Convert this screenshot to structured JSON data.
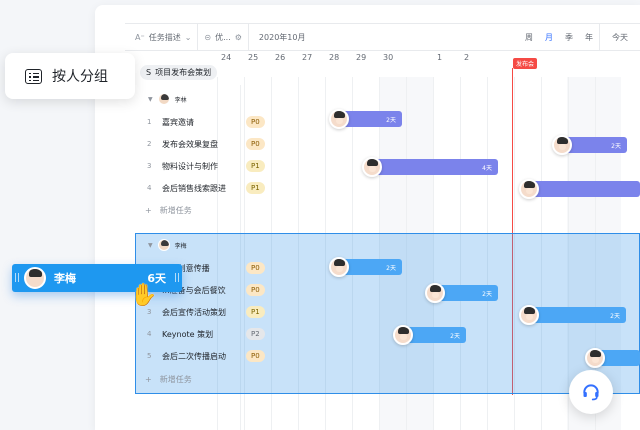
{
  "toolbar": {
    "task_desc": "任务描述",
    "priority": "优...",
    "month": "2020年10月",
    "views": [
      "周",
      "月",
      "季",
      "年"
    ],
    "active_view": "月",
    "today": "今天"
  },
  "dates": [
    "24",
    "25",
    "26",
    "27",
    "28",
    "29",
    "30",
    "1",
    "2"
  ],
  "today_flag": "发布会",
  "project": {
    "tag": "S",
    "name": "项目发布会策划"
  },
  "groups": [
    {
      "owner": "李林",
      "tasks": [
        {
          "num": "1",
          "name": "嘉宾邀请",
          "priority": "P0",
          "duration": "2天"
        },
        {
          "num": "2",
          "name": "发布会效果复盘",
          "priority": "P0",
          "duration": "2天"
        },
        {
          "num": "3",
          "name": "物料设计与制作",
          "priority": "P1",
          "duration": "4天"
        },
        {
          "num": "4",
          "name": "会后销售线索跟进",
          "priority": "P1",
          "duration": ""
        }
      ],
      "add_task": "新增任务"
    },
    {
      "owner": "李梅",
      "tasks": [
        {
          "num": "1",
          "name": "...段创意传播",
          "priority": "P0",
          "duration": "2天"
        },
        {
          "num": "2",
          "name": "...准备与会后餐饮",
          "priority": "P0",
          "duration": "2天"
        },
        {
          "num": "3",
          "name": "会后宣传活动策划",
          "priority": "P1",
          "duration": "2天"
        },
        {
          "num": "4",
          "name": "Keynote 策划",
          "priority": "P2",
          "duration": "2天"
        },
        {
          "num": "5",
          "name": "会后二次传播启动",
          "priority": "P0",
          "duration": ""
        }
      ],
      "add_task": "新增任务"
    }
  ],
  "chip": {
    "label": "按人分组"
  },
  "drag_card": {
    "name": "李梅",
    "duration": "6天"
  },
  "colors": {
    "accent": "#3370ff",
    "purple_bar": "#7b83eb",
    "blue_bar": "#4ca7f5",
    "today_line": "#f54a45"
  }
}
